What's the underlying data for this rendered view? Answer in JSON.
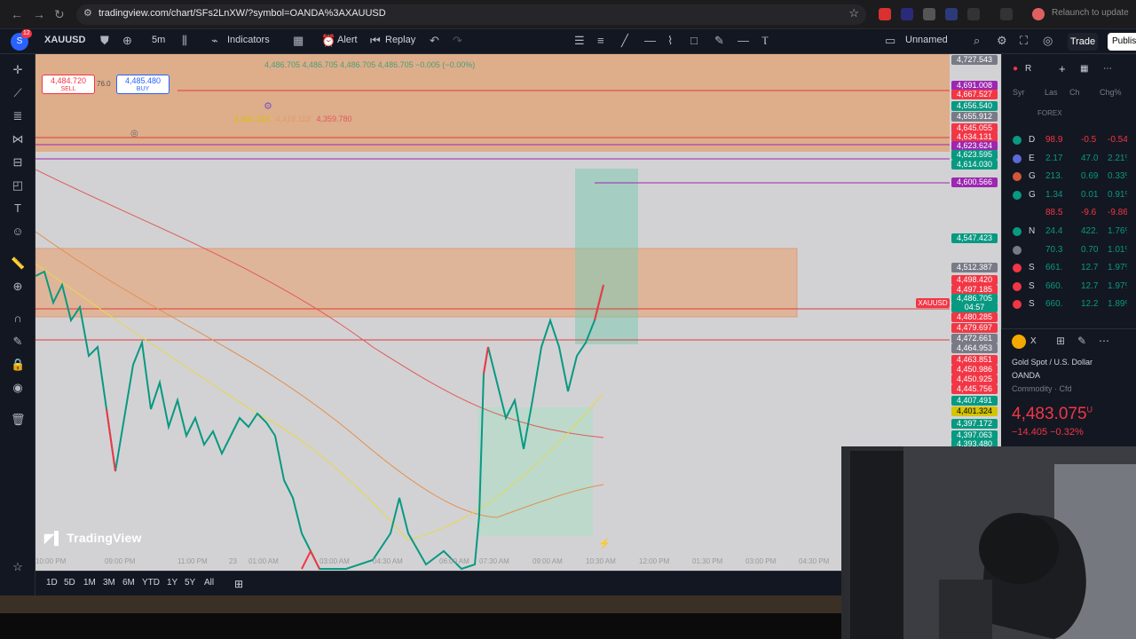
{
  "browser": {
    "url": "tradingview.com/chart/SFs2LnXW/?symbol=OANDA%3AXAUUSD",
    "relaunch": "Relaunch to update"
  },
  "toolbar": {
    "avatar_badge": "12",
    "symbol": "XAUUSD",
    "interval": "5m",
    "indicators": "Indicators",
    "alert": "Alert",
    "replay": "Replay",
    "layout_name": "Unnamed",
    "trade": "Trade",
    "publish": "Publis"
  },
  "chart": {
    "sell_price": "4,484.720",
    "sell_label": "SELL",
    "buy_price": "4,485.480",
    "buy_label": "BUY",
    "spread": "76.0",
    "ohlc": "4,486.705  4,486.705  4,486.705  4,486.705  −0.005 (−0.00%)",
    "indicator_value_1": "4,401.324",
    "indicator_value_2": "4,418.113",
    "indicator_value_3": "4,359.780",
    "logo": "TradingView",
    "symbol_tag": "XAUUSD",
    "time_labels": [
      "10:00 PM",
      "09:00 PM",
      "11:00 PM",
      "23",
      "01:00 AM",
      "03:00 AM",
      "04:30 AM",
      "06:00 AM",
      "07:30 AM",
      "09:00 AM",
      "10:30 AM",
      "12:00 PM",
      "01:30 PM",
      "03:00 PM",
      "04:30 PM"
    ],
    "price_labels": [
      {
        "text": "4,727.543",
        "color": "#787b86"
      },
      {
        "text": "4,691.008",
        "color": "#9c27b0"
      },
      {
        "text": "4,667.527",
        "color": "#f23645"
      },
      {
        "text": "4,656.540",
        "color": "#089981"
      },
      {
        "text": "4,655.912",
        "color": "#787b86"
      },
      {
        "text": "4,645.055",
        "color": "#f23645"
      },
      {
        "text": "4,634.131",
        "color": "#f23645"
      },
      {
        "text": "4,623.624",
        "color": "#9c27b0"
      },
      {
        "text": "4,623.595",
        "color": "#089981"
      },
      {
        "text": "4,614.030",
        "color": "#089981"
      },
      {
        "text": "4,600.566",
        "color": "#9c27b0"
      },
      {
        "text": "4,547.423",
        "color": "#089981"
      },
      {
        "text": "4,512.387",
        "color": "#787b86"
      },
      {
        "text": "4,498.420",
        "color": "#f23645"
      },
      {
        "text": "4,497.185",
        "color": "#f23645"
      },
      {
        "text": "4,486.705",
        "color": "#089981"
      },
      {
        "text": "04:57",
        "color": "#089981"
      },
      {
        "text": "4,480.285",
        "color": "#f23645"
      },
      {
        "text": "4,479.697",
        "color": "#f23645"
      },
      {
        "text": "4,472.661",
        "color": "#787b86"
      },
      {
        "text": "4,464.953",
        "color": "#787b86"
      },
      {
        "text": "4,463.851",
        "color": "#f23645"
      },
      {
        "text": "4,450.986",
        "color": "#f23645"
      },
      {
        "text": "4,450.925",
        "color": "#f23645"
      },
      {
        "text": "4,445.756",
        "color": "#f23645"
      },
      {
        "text": "4,407.491",
        "color": "#089981"
      },
      {
        "text": "4,401.324",
        "color": "#d4c400"
      },
      {
        "text": "4,397.172",
        "color": "#089981"
      },
      {
        "text": "4,397.063",
        "color": "#089981"
      },
      {
        "text": "4,393.480",
        "color": "#089981"
      }
    ]
  },
  "ranges": [
    "1D",
    "5D",
    "1M",
    "3M",
    "6M",
    "YTD",
    "1Y",
    "5Y",
    "All"
  ],
  "watchlist": {
    "title": "R",
    "columns": [
      "Syr",
      "Las",
      "Ch",
      "Chg%"
    ],
    "section": "FOREX",
    "rows": [
      {
        "sym": "D",
        "last": "98.9",
        "chg": "-0.5",
        "pct": "-0.54%",
        "color": "#f23645",
        "dot": "#089981"
      },
      {
        "sym": "E",
        "last": "2.17",
        "chg": "47.0",
        "pct": "2.21%",
        "color": "#089981",
        "dot": "#5b6ad6"
      },
      {
        "sym": "G",
        "last": "213.",
        "chg": "0.69",
        "pct": "0.33%",
        "color": "#089981",
        "dot": "#d4573a"
      },
      {
        "sym": "G",
        "last": "1.34",
        "chg": "0.01",
        "pct": "0.91%",
        "color": "#089981",
        "dot": "#089981"
      },
      {
        "sym": "",
        "last": "88.5",
        "chg": "-9.6",
        "pct": "-9.86%",
        "color": "#f23645",
        "dot": "#131722"
      },
      {
        "sym": "N",
        "last": "24.4",
        "chg": "422.",
        "pct": "1.76%",
        "color": "#089981",
        "dot": "#089981"
      },
      {
        "sym": "",
        "last": "70.3",
        "chg": "0.70",
        "pct": "1.01%",
        "color": "#089981",
        "dot": "#787b86"
      },
      {
        "sym": "S",
        "last": "661.",
        "chg": "12.7",
        "pct": "1.97%",
        "color": "#089981",
        "dot": "#f23645"
      },
      {
        "sym": "S",
        "last": "660.",
        "chg": "12.7",
        "pct": "1.97%",
        "color": "#089981",
        "dot": "#f23645"
      },
      {
        "sym": "S",
        "last": "660.",
        "chg": "12.2",
        "pct": "1.89%",
        "color": "#089981",
        "dot": "#f23645"
      }
    ]
  },
  "detail": {
    "symbol": "X",
    "name": "Gold Spot / U.S. Dollar",
    "exchange": "OANDA",
    "category": "Commodity · Cfd",
    "price": "4,483.075",
    "unit": "U",
    "change": "−14.405  −0.32%"
  }
}
